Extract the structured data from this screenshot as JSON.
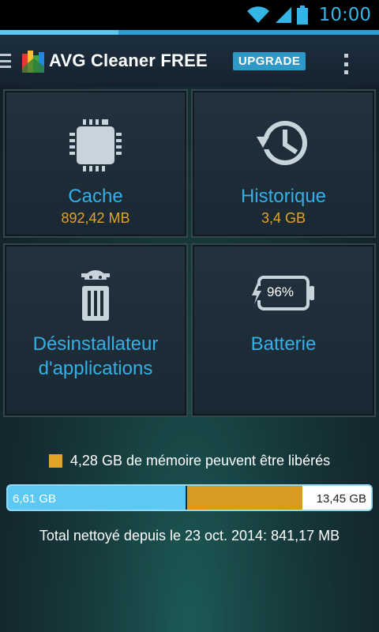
{
  "status_bar": {
    "time": "10:00"
  },
  "header": {
    "title": "AVG Cleaner FREE",
    "upgrade_label": "UPGRADE"
  },
  "tiles": [
    {
      "label": "Cache",
      "value": "892,42 MB",
      "icon": "chip-icon"
    },
    {
      "label": "Historique",
      "value": "3,4 GB",
      "icon": "history-clock-icon"
    },
    {
      "label_line1": "Désinstallateur",
      "label_line2": "d'applications",
      "icon": "android-trash-icon"
    },
    {
      "label": "Batterie",
      "battery_level": "96%",
      "icon": "battery-icon"
    }
  ],
  "storage": {
    "legend": "4,28 GB de mémoire peuvent être libérés",
    "used_label": "6,61 GB",
    "total_label": "13,45 GB",
    "used_fraction": 0.49,
    "freeable_fraction": 0.32
  },
  "total_cleaned": "Total nettoyé depuis le 23 oct. 2014: 841,17 MB",
  "colors": {
    "accent_blue": "#34b0e6",
    "value_orange": "#e3a328",
    "status_blue": "#33b5e5"
  }
}
